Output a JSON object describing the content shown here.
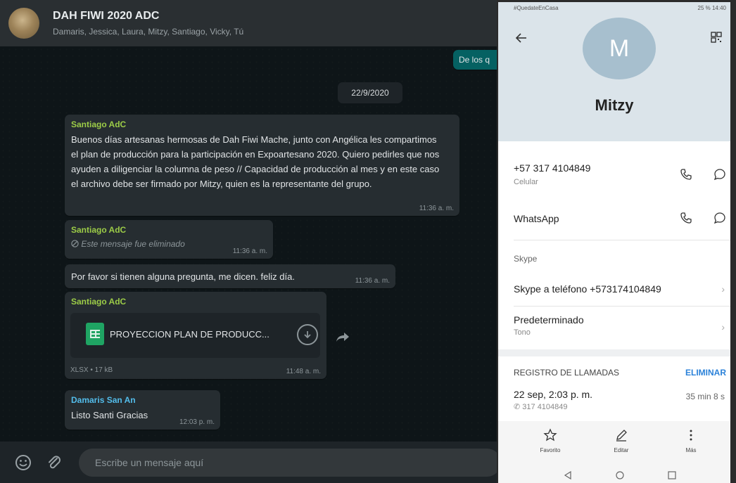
{
  "whatsapp": {
    "group_title": "DAH FIWI 2020 ADC",
    "group_members": "Damaris, Jessica, Laura, Mitzy, Santiago, Vicky, Tú",
    "outgoing_fragment": "De los q",
    "date_chip": "22/9/2020",
    "messages": [
      {
        "sender": "Santiago AdC",
        "text": "Buenos días artesanas hermosas de Dah Fiwi Mache, junto con Angélica les compartimos el plan de producción para la participación en Expoartesano 2020. Quiero pedirles que nos ayuden a diligenciar la columna de peso // Capacidad de producción al mes y en este caso el archivo debe ser firmado por Mitzy, quien es la representante del grupo.",
        "time": "11:36 a. m."
      },
      {
        "sender": "Santiago AdC",
        "text": "Este mensaje fue eliminado",
        "time": "11:36 a. m."
      },
      {
        "sender": "",
        "text": "Por favor si tienen alguna pregunta, me dicen. feliz día.",
        "time": "11:36 a. m."
      },
      {
        "sender": "Santiago AdC",
        "doc_name": "PROYECCION PLAN DE PRODUCC...",
        "doc_meta": "XLSX • 17 kB",
        "time": "11:48 a. m."
      },
      {
        "sender": "Damaris San An",
        "text": "Listo  Santi Gracias",
        "time": "12:03 p. m."
      }
    ],
    "compose_placeholder": "Escribe un mensaje aquí",
    "icons": [
      "emoji-icon",
      "attach-icon",
      "forward-icon",
      "download-icon"
    ]
  },
  "phone": {
    "status_left": "#QuedateEnCasa",
    "status_right": "25 % 14:40",
    "avatar_letter": "M",
    "contact_name": "Mitzy",
    "number": "+57 317 4104849",
    "number_type": "Celular",
    "whatsapp_label": "WhatsApp",
    "skype_header": "Skype",
    "skype_call": "Skype a teléfono +573174104849",
    "default_label": "Predeterminado",
    "default_sub": "Tono",
    "call_log_header": "REGISTRO DE LLAMADAS",
    "call_log_action": "ELIMINAR",
    "call_entry_date": "22 sep, 2:03 p. m.",
    "call_entry_number": "317 4104849",
    "call_entry_duration": "35 min 8 s",
    "actions": {
      "favorite": "Favorito",
      "edit": "Editar",
      "more": "Más"
    },
    "accent_color": "#2b82d9"
  }
}
